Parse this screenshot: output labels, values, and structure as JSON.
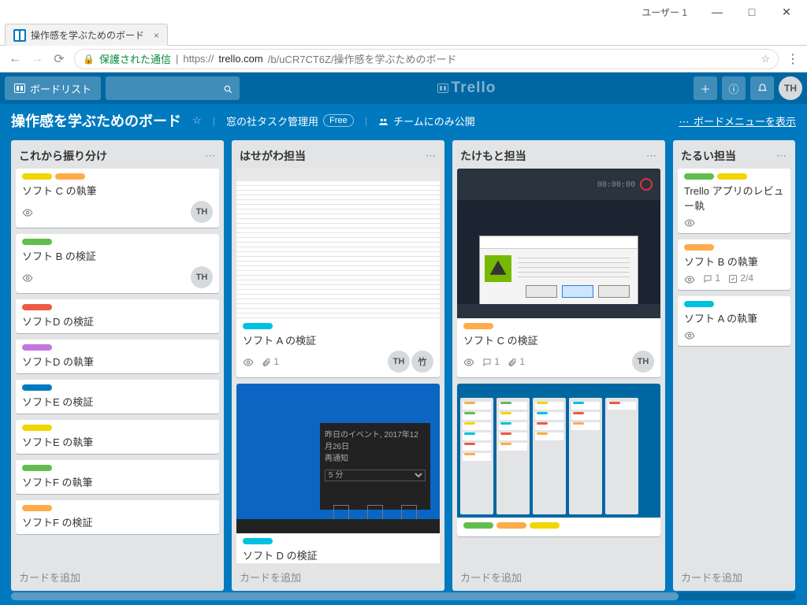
{
  "window": {
    "user": "ユーザー 1"
  },
  "browser": {
    "tab_title": "操作感を学ぶためのボード",
    "secure_label": "保護された通信",
    "url_prefix": "https://",
    "url_host": "trello.com",
    "url_path": "/b/uCR7CT6Z/操作感を学ぶためのボード"
  },
  "app": {
    "board_list_label": "ボードリスト",
    "logo": "Trello",
    "avatar": "TH",
    "board_title": "操作感を学ぶためのボード",
    "team": "窓の社タスク管理用",
    "free_badge": "Free",
    "visibility": "チームにのみ公開",
    "menu_link": "ボードメニューを表示"
  },
  "lists": [
    {
      "title": "これから振り分け",
      "add": "カードを追加",
      "cards": [
        {
          "labels": [
            "y",
            "o"
          ],
          "title": "ソフト C の執筆",
          "watch": true,
          "member": "TH"
        },
        {
          "labels": [
            "g"
          ],
          "title": "ソフト B の検証",
          "watch": true,
          "member": "TH"
        },
        {
          "labels": [
            "r"
          ],
          "title": "ソフトD の検証"
        },
        {
          "labels": [
            "p"
          ],
          "title": "ソフトD の執筆"
        },
        {
          "labels": [
            "b"
          ],
          "title": "ソフトE の検証"
        },
        {
          "labels": [
            "y"
          ],
          "title": "ソフトE の執筆"
        },
        {
          "labels": [
            "g"
          ],
          "title": "ソフトF の執筆"
        },
        {
          "labels": [
            "o"
          ],
          "title": "ソフトF の検証"
        }
      ]
    },
    {
      "title": "はせがわ担当",
      "add": "カードを追加",
      "cards": [
        {
          "cover": "editor",
          "labels": [
            "sky"
          ],
          "title": "ソフト A の検証",
          "watch": true,
          "attach": "1",
          "members": [
            "TH",
            "竹"
          ]
        },
        {
          "cover": "desktop",
          "labels": [
            "sky"
          ],
          "title": "ソフト D の検証"
        }
      ]
    },
    {
      "title": "たけもと担当",
      "add": "カードを追加",
      "cards": [
        {
          "cover": "dark",
          "labels": [
            "o"
          ],
          "title": "ソフト C の検証",
          "watch": true,
          "comments": "1",
          "attach": "1",
          "member": "TH"
        },
        {
          "cover": "board",
          "labels": [
            "g",
            "o",
            "y"
          ],
          "title": ""
        }
      ]
    },
    {
      "title": "たるい担当",
      "add": "カードを追加",
      "narrow": true,
      "cards": [
        {
          "labels": [
            "g",
            "y"
          ],
          "title": "Trello アプリのレビュー執",
          "watch": true
        },
        {
          "labels": [
            "o"
          ],
          "title": "ソフト B の執筆",
          "watch": true,
          "comments": "1",
          "checklist": "2/4"
        },
        {
          "labels": [
            "sky"
          ],
          "title": "ソフト A の執筆",
          "watch": true
        }
      ]
    }
  ],
  "cover_text": {
    "desktop_title": "昨日のイベント, 2017年12月26日",
    "desktop_sub": "再通知",
    "desktop_opt": "5 分",
    "dark_time": "00:00:00"
  }
}
